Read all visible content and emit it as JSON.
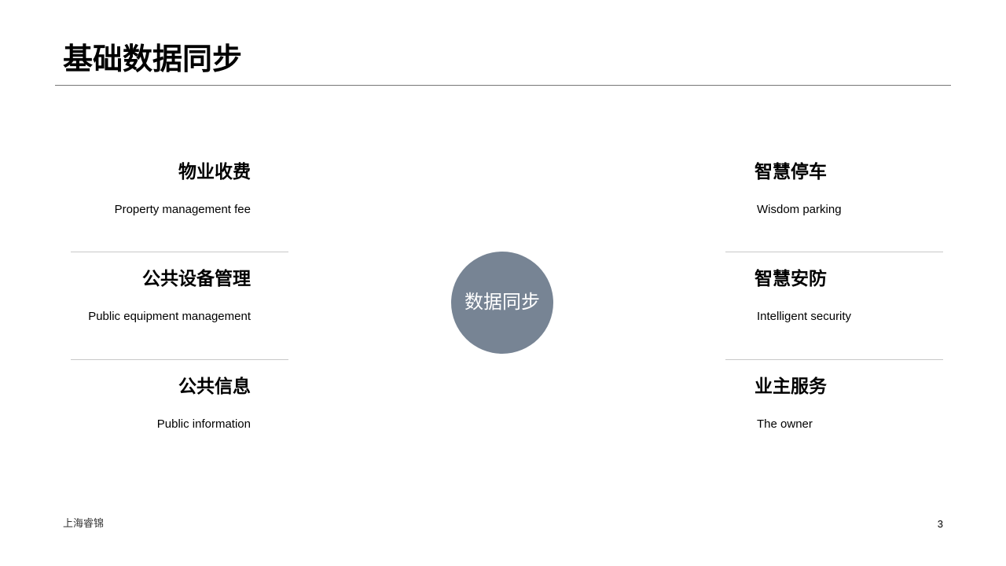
{
  "slide": {
    "title": "基础数据同步",
    "center_label": "数据同步",
    "left_items": [
      {
        "title": "物业收费",
        "subtitle": "Property management fee"
      },
      {
        "title": "公共设备管理",
        "subtitle": "Public equipment management"
      },
      {
        "title": "公共信息",
        "subtitle": "Public information"
      }
    ],
    "right_items": [
      {
        "title": "智慧停车",
        "subtitle": "Wisdom parking"
      },
      {
        "title": "智慧安防",
        "subtitle": "Intelligent security"
      },
      {
        "title": "业主服务",
        "subtitle": "The owner"
      }
    ],
    "footer": {
      "company": "上海睿锦",
      "page_number": "3"
    }
  },
  "colors": {
    "hub_fill": "#778494",
    "title_rule": "#777777",
    "divider": "#c8c8c8",
    "text": "#000000"
  }
}
